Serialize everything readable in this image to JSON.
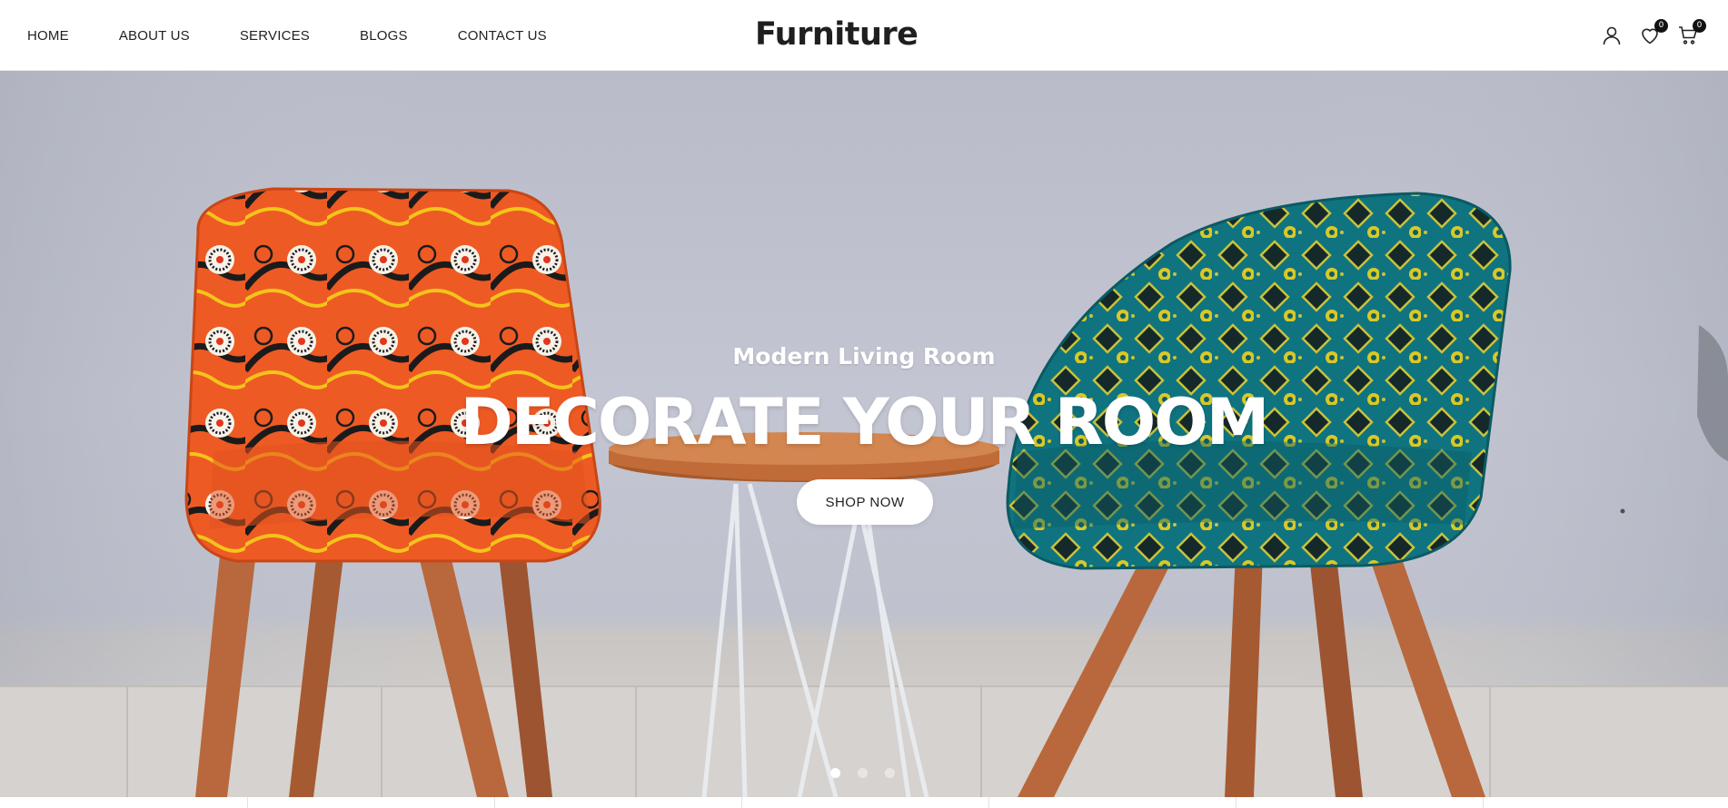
{
  "header": {
    "logo": "Furniture",
    "nav": [
      {
        "label": "HOME"
      },
      {
        "label": "ABOUT US"
      },
      {
        "label": "SERVICES"
      },
      {
        "label": "BLOGS"
      },
      {
        "label": "CONTACT US"
      }
    ],
    "icons": {
      "account": "user-icon",
      "wishlist": "heart-icon",
      "cart": "cart-icon"
    },
    "wishlist_count": "0",
    "cart_count": "0"
  },
  "hero": {
    "subtitle": "Modern Living Room",
    "title": "DECORATE YOUR ROOM",
    "button_label": "SHOP NOW",
    "slides": 3,
    "active_slide": 1,
    "image": "two patterned armchairs (orange and teal) with a round wooden side table"
  },
  "colors": {
    "wall": "#bfc2cd",
    "chair_left": "#ef5a23",
    "chair_right": "#0f7480",
    "wood": "#b8683c"
  }
}
